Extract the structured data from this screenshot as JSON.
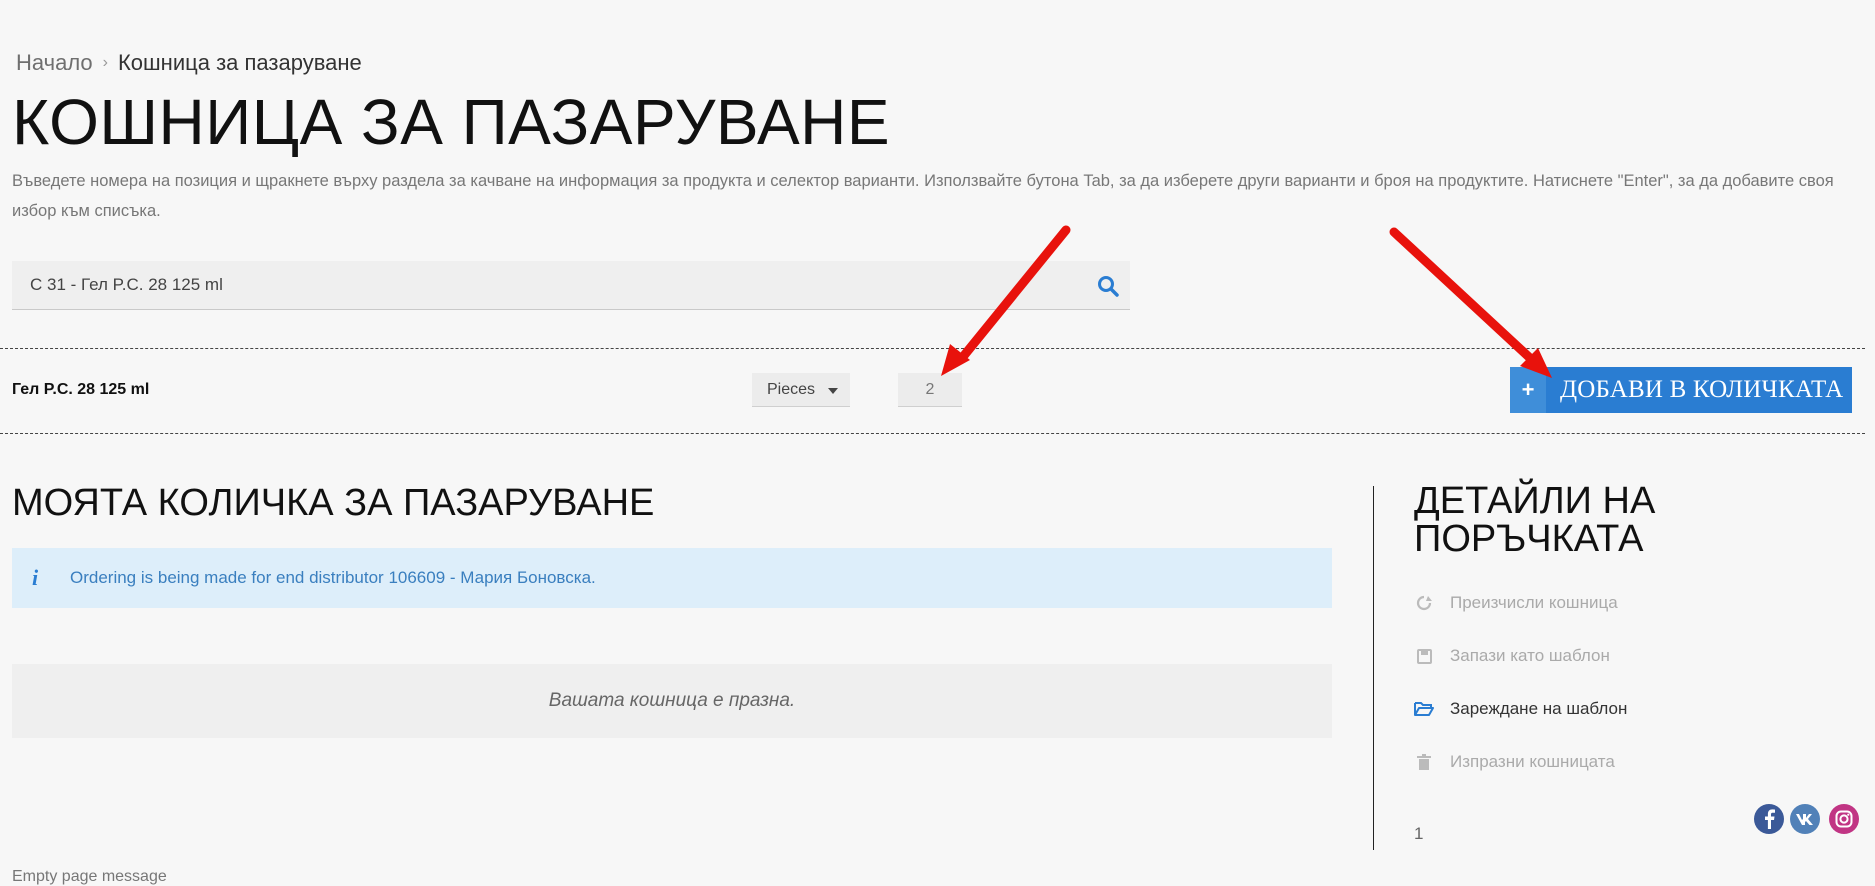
{
  "breadcrumb": {
    "home": "Начало",
    "separator": "›",
    "current": "Кошница за пазаруване"
  },
  "page_title": "КОШНИЦА ЗА ПАЗАРУВАНЕ",
  "intro_text": "Въведете номера на позиция и щракнете върху раздела за качване на информация за продукта и селектор варианти. Използвайте бутона Tab, за да изберете други варианти и броя на продуктите. Натиснете \"Enter\", за да добавите своя избор към списъка.",
  "search": {
    "value": "C 31 - Гел P.C. 28 125 ml",
    "icon": "search-icon"
  },
  "product": {
    "name": "Гел P.C. 28 125 ml",
    "unit": "Pieces",
    "quantity": "2",
    "add_plus": "+",
    "add_label": "ДОБАВИ В КОЛИЧКАТА"
  },
  "cart": {
    "title": "МОЯТА КОЛИЧКА ЗА ПАЗАРУВАНЕ",
    "info_icon": "i",
    "info": "Ordering is being made for end distributor 106609 - Мария Боновска.",
    "empty": "Вашата кошница е празна.",
    "bottom_text": "Empty page message"
  },
  "sidebar": {
    "title": "ДЕТАЙЛИ НА ПОРЪЧКАТА",
    "items": [
      {
        "label": "Преизчисли кошница",
        "icon": "recalculate-icon",
        "enabled": false
      },
      {
        "label": "Запази като шаблон",
        "icon": "save-icon",
        "enabled": false
      },
      {
        "label": "Зареждане на шаблон",
        "icon": "folder-open-icon",
        "enabled": true
      },
      {
        "label": "Изпразни кошницата",
        "icon": "trash-icon",
        "enabled": false
      }
    ],
    "number": "1"
  },
  "social": [
    {
      "name": "facebook-icon",
      "color": "#3b5998"
    },
    {
      "name": "vk-icon",
      "color": "#5181b8"
    },
    {
      "name": "instagram-icon",
      "color": "#c13584"
    }
  ],
  "colors": {
    "accent": "#2a7dd2",
    "info_bg": "#ddeefa",
    "annotation": "#e8120c"
  }
}
